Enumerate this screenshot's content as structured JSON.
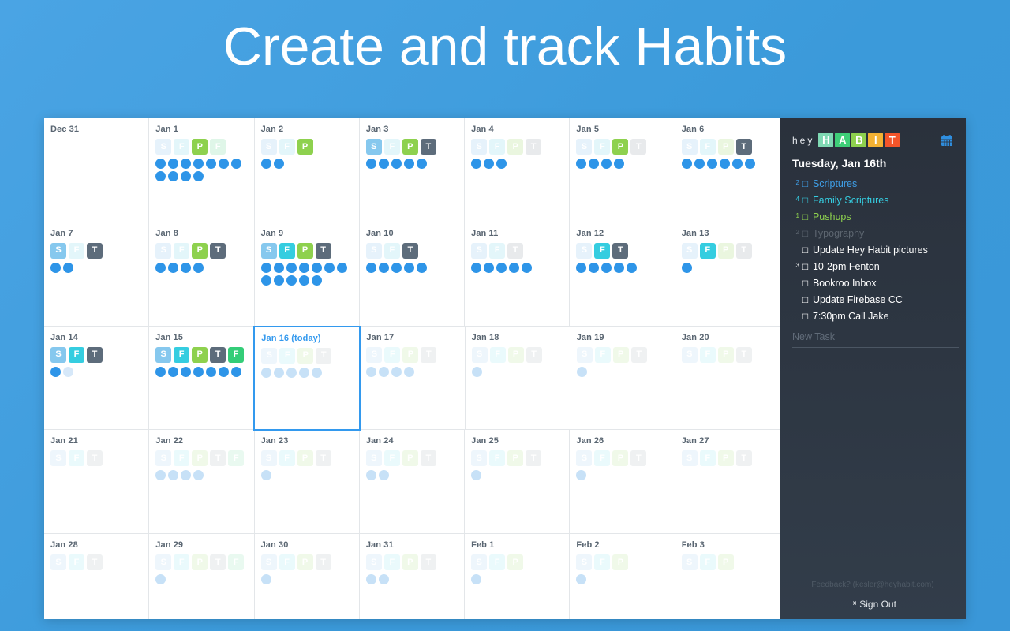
{
  "headline": "Create and track Habits",
  "colors": {
    "background": "#3d9ce0",
    "accent": "#3399ee",
    "sidebar_bg": "#2d3642",
    "dot_active": "#2e95e8",
    "dot_pale": "#c7e1f7"
  },
  "sidebar": {
    "logo_prefix": "hey",
    "logo_letters": [
      {
        "char": "H",
        "color": "#7fd9b3"
      },
      {
        "char": "A",
        "color": "#3ecf78"
      },
      {
        "char": "B",
        "color": "#8ed14e"
      },
      {
        "char": "I",
        "color": "#f4b233"
      },
      {
        "char": "T",
        "color": "#f4552a"
      }
    ],
    "calendar_icon": "calendar-icon",
    "today_date": "Tuesday, Jan 16th",
    "tasks": [
      {
        "count": "2",
        "label": "Scriptures",
        "tone": "t-blue",
        "checkbox": "☐"
      },
      {
        "count": "4",
        "label": "Family Scriptures",
        "tone": "t-cyan",
        "checkbox": "☐"
      },
      {
        "count": "1",
        "label": "Pushups",
        "tone": "t-green",
        "checkbox": "☐"
      },
      {
        "count": "2",
        "label": "Typography",
        "tone": "t-gray",
        "checkbox": "☐"
      },
      {
        "count": "",
        "label": "Update Hey Habit pictures",
        "tone": "t-white",
        "checkbox": "☐"
      },
      {
        "count": "3",
        "label": "10-2pm Fenton",
        "tone": "t-white",
        "checkbox": "☐"
      },
      {
        "count": "",
        "label": "Bookroo Inbox",
        "tone": "t-white",
        "checkbox": "☐"
      },
      {
        "count": "",
        "label": "Update Firebase CC",
        "tone": "t-white",
        "checkbox": "☐"
      },
      {
        "count": "",
        "label": "7:30pm Call Jake",
        "tone": "t-white",
        "checkbox": "☐"
      }
    ],
    "new_task_placeholder": "New Task",
    "new_task_value": "",
    "feedback": "Feedback? (kesler@heyhabit.com)",
    "sign_out": "Sign Out",
    "sign_out_icon": "⇥"
  },
  "calendar": {
    "today_suffix": "(today)",
    "rows": [
      [
        {
          "label": "Dec 31",
          "badges": [],
          "dots": 0,
          "dot_tone": "on"
        },
        {
          "label": "Jan 1",
          "badges": [
            "s-off",
            "f-off",
            "p-on",
            "g-off"
          ],
          "dots": 11,
          "dot_tone": "on"
        },
        {
          "label": "Jan 2",
          "badges": [
            "s-off",
            "f-off",
            "p-on"
          ],
          "dots": 2,
          "dot_tone": "on"
        },
        {
          "label": "Jan 3",
          "badges": [
            "s-on",
            "f-off",
            "p-on",
            "t-on"
          ],
          "dots": 5,
          "dot_tone": "on"
        },
        {
          "label": "Jan 4",
          "badges": [
            "s-off",
            "f-off",
            "p-off",
            "t-off"
          ],
          "dots": 3,
          "dot_tone": "on"
        },
        {
          "label": "Jan 5",
          "badges": [
            "s-off",
            "f-off",
            "p-on",
            "t-off"
          ],
          "dots": 4,
          "dot_tone": "on"
        },
        {
          "label": "Jan 6",
          "badges": [
            "s-off",
            "f-off",
            "p-off",
            "t-on"
          ],
          "dots": 6,
          "dot_tone": "on"
        }
      ],
      [
        {
          "label": "Jan 7",
          "badges": [
            "s-on",
            "f-off",
            "t-on"
          ],
          "dots": 2,
          "dot_tone": "on"
        },
        {
          "label": "Jan 8",
          "badges": [
            "s-off",
            "f-off",
            "p-on",
            "t-on"
          ],
          "dots": 4,
          "dot_tone": "on"
        },
        {
          "label": "Jan 9",
          "badges": [
            "s-on",
            "f-on",
            "p-on",
            "t-on"
          ],
          "dots": 12,
          "dot_tone": "on"
        },
        {
          "label": "Jan 10",
          "badges": [
            "s-off",
            "f-off",
            "t-on"
          ],
          "dots": 5,
          "dot_tone": "on"
        },
        {
          "label": "Jan 11",
          "badges": [
            "s-off",
            "f-off",
            "t-off"
          ],
          "dots": 5,
          "dot_tone": "on"
        },
        {
          "label": "Jan 12",
          "badges": [
            "s-off",
            "f-on",
            "t-on"
          ],
          "dots": 5,
          "dot_tone": "on"
        },
        {
          "label": "Jan 13",
          "badges": [
            "s-off",
            "f-on",
            "p-off",
            "t-off"
          ],
          "dots": 1,
          "dot_tone": "on"
        }
      ],
      [
        {
          "label": "Jan 14",
          "badges": [
            "s-on",
            "f-on",
            "t-on"
          ],
          "dots": 2,
          "dot_tone": "mixed1"
        },
        {
          "label": "Jan 15",
          "badges": [
            "s-on",
            "f-on",
            "p-on",
            "t-on",
            "g-on"
          ],
          "dots": 7,
          "dot_tone": "on"
        },
        {
          "label": "Jan 16",
          "today": true,
          "badges": [
            "s-dim",
            "f-dim",
            "p-dim",
            "t-dim"
          ],
          "dots": 5,
          "dot_tone": "pale"
        },
        {
          "label": "Jan 17",
          "badges": [
            "s-dim",
            "f-dim",
            "p-dim",
            "t-dim"
          ],
          "dots": 4,
          "dot_tone": "pale"
        },
        {
          "label": "Jan 18",
          "badges": [
            "s-dim",
            "f-dim",
            "p-dim",
            "t-dim"
          ],
          "dots": 1,
          "dot_tone": "pale"
        },
        {
          "label": "Jan 19",
          "badges": [
            "s-dim",
            "f-dim",
            "p-dim",
            "t-dim"
          ],
          "dots": 1,
          "dot_tone": "pale"
        },
        {
          "label": "Jan 20",
          "badges": [
            "s-dim",
            "f-dim",
            "p-dim",
            "t-dim"
          ],
          "dots": 0,
          "dot_tone": "pale"
        }
      ],
      [
        {
          "label": "Jan 21",
          "badges": [
            "s-dim",
            "f-dim",
            "t-dim"
          ],
          "dots": 0,
          "dot_tone": "pale"
        },
        {
          "label": "Jan 22",
          "badges": [
            "s-dim",
            "f-dim",
            "p-dim",
            "t-dim",
            "g-dim"
          ],
          "dots": 4,
          "dot_tone": "pale"
        },
        {
          "label": "Jan 23",
          "badges": [
            "s-dim",
            "f-dim",
            "p-dim",
            "t-dim"
          ],
          "dots": 1,
          "dot_tone": "pale"
        },
        {
          "label": "Jan 24",
          "badges": [
            "s-dim",
            "f-dim",
            "p-dim",
            "t-dim"
          ],
          "dots": 2,
          "dot_tone": "pale"
        },
        {
          "label": "Jan 25",
          "badges": [
            "s-dim",
            "f-dim",
            "p-dim",
            "t-dim"
          ],
          "dots": 1,
          "dot_tone": "pale"
        },
        {
          "label": "Jan 26",
          "badges": [
            "s-dim",
            "f-dim",
            "p-dim",
            "t-dim"
          ],
          "dots": 1,
          "dot_tone": "pale"
        },
        {
          "label": "Jan 27",
          "badges": [
            "s-dim",
            "f-dim",
            "p-dim",
            "t-dim"
          ],
          "dots": 0,
          "dot_tone": "pale"
        }
      ],
      [
        {
          "label": "Jan 28",
          "badges": [
            "s-dim",
            "f-dim",
            "t-dim"
          ],
          "dots": 0,
          "dot_tone": "pale"
        },
        {
          "label": "Jan 29",
          "badges": [
            "s-dim",
            "f-dim",
            "p-dim",
            "t-dim",
            "g-dim"
          ],
          "dots": 1,
          "dot_tone": "pale"
        },
        {
          "label": "Jan 30",
          "badges": [
            "s-dim",
            "f-dim",
            "p-dim",
            "t-dim"
          ],
          "dots": 1,
          "dot_tone": "pale"
        },
        {
          "label": "Jan 31",
          "badges": [
            "s-dim",
            "f-dim",
            "p-dim",
            "t-dim"
          ],
          "dots": 2,
          "dot_tone": "pale"
        },
        {
          "label": "Feb 1",
          "badges": [
            "s-dim",
            "f-dim",
            "p-dim"
          ],
          "dots": 1,
          "dot_tone": "pale"
        },
        {
          "label": "Feb 2",
          "badges": [
            "s-dim",
            "f-dim",
            "p-dim"
          ],
          "dots": 1,
          "dot_tone": "pale"
        },
        {
          "label": "Feb 3",
          "badges": [
            "s-dim",
            "f-dim",
            "p-dim"
          ],
          "dots": 0,
          "dot_tone": "pale"
        }
      ]
    ]
  }
}
